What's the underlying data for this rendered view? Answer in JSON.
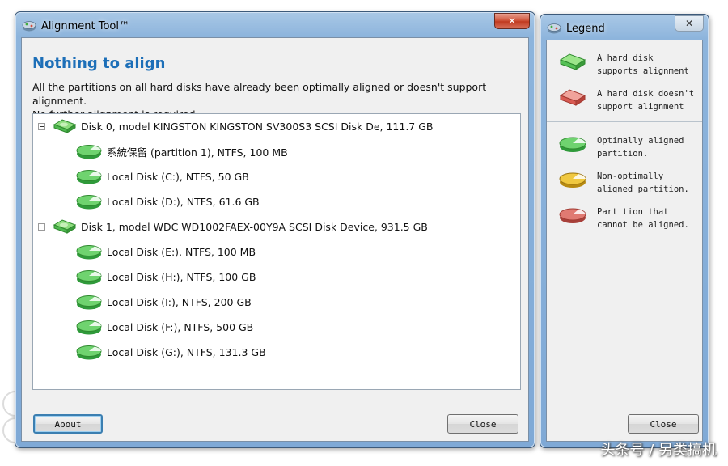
{
  "main_window": {
    "title": "Alignment Tool™",
    "close_glyph": "✕",
    "heading": "Nothing to align",
    "description_line1": "All the partitions on all hard disks have already been optimally aligned or doesn't support alignment.",
    "description_line2": "No further alignment is required.",
    "tree": [
      {
        "kind": "disk",
        "label": "Disk 0, model KINGSTON KINGSTON SV300S3 SCSI Disk De, 111.7 GB",
        "status": "supported",
        "icon": "hard-disk-icon"
      },
      {
        "kind": "partition",
        "label": "系統保留 (partition 1), NTFS, 100 MB",
        "status": "optimal",
        "icon": "partition-icon"
      },
      {
        "kind": "partition",
        "label": "Local Disk (C:), NTFS, 50 GB",
        "status": "optimal",
        "icon": "partition-icon"
      },
      {
        "kind": "partition",
        "label": "Local Disk (D:), NTFS, 61.6 GB",
        "status": "optimal",
        "icon": "partition-icon"
      },
      {
        "kind": "disk",
        "label": "Disk 1, model WDC WD1002FAEX-00Y9A SCSI Disk Device, 931.5 GB",
        "status": "supported",
        "icon": "hard-disk-icon"
      },
      {
        "kind": "partition",
        "label": "Local Disk (E:), NTFS, 100 MB",
        "status": "optimal",
        "icon": "partition-icon"
      },
      {
        "kind": "partition",
        "label": "Local Disk (H:), NTFS, 100 GB",
        "status": "optimal",
        "icon": "partition-icon"
      },
      {
        "kind": "partition",
        "label": "Local Disk (I:), NTFS, 200 GB",
        "status": "optimal",
        "icon": "partition-icon"
      },
      {
        "kind": "partition",
        "label": "Local Disk (F:), NTFS, 500 GB",
        "status": "optimal",
        "icon": "partition-icon"
      },
      {
        "kind": "partition",
        "label": "Local Disk (G:), NTFS, 131.3 GB",
        "status": "optimal",
        "icon": "partition-icon"
      }
    ],
    "about_label": "About",
    "close_label": "Close"
  },
  "legend_window": {
    "title": "Legend",
    "close_glyph": "✕",
    "disk_items": [
      {
        "line1": "A hard disk",
        "line2": "supports alignment",
        "color": "#5cc25c"
      },
      {
        "line1": "A hard disk doesn't",
        "line2": "support alignment",
        "color": "#d85a52"
      }
    ],
    "partition_items": [
      {
        "line1": "Optimally aligned",
        "line2": "partition.",
        "color": "#4fbf5a"
      },
      {
        "line1": "Non-optimally",
        "line2": "aligned partition.",
        "color": "#e0b020"
      },
      {
        "line1": "Partition that",
        "line2": "cannot be aligned.",
        "color": "#d45a55"
      }
    ],
    "close_label": "Close"
  },
  "colors": {
    "heading": "#1d6fb8",
    "supported": "#5cc25c",
    "optimal": "#4fbf5a",
    "window_frame": "#8db4dc"
  },
  "watermark": "头条号 / 另类搞机"
}
